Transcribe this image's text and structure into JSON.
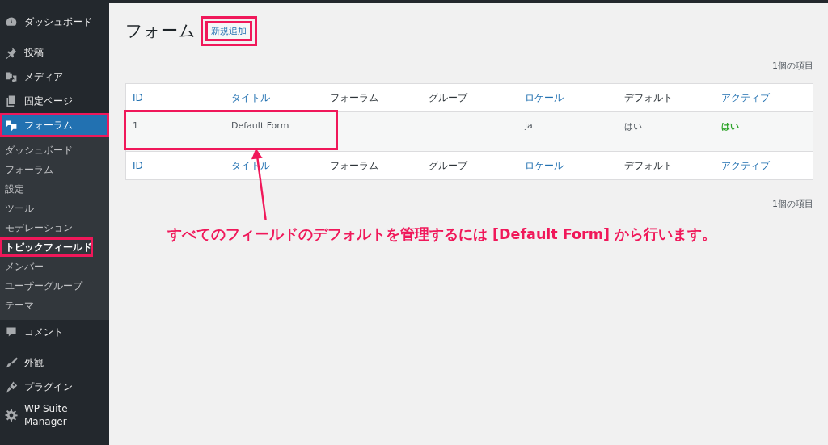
{
  "sidebar": {
    "groups": [
      [
        {
          "label": "ダッシュボード",
          "selected": false,
          "highlighted": false
        }
      ],
      [
        {
          "label": "投稿",
          "selected": false,
          "highlighted": false
        },
        {
          "label": "メディア",
          "selected": false,
          "highlighted": false
        },
        {
          "label": "固定ページ",
          "selected": false,
          "highlighted": false
        },
        {
          "label": "フォーラム",
          "selected": true,
          "highlighted": true,
          "children": [
            {
              "label": "ダッシュボード",
              "selected": false,
              "highlighted": false
            },
            {
              "label": "フォーラム",
              "selected": false,
              "highlighted": false
            },
            {
              "label": "設定",
              "selected": false,
              "highlighted": false
            },
            {
              "label": "ツール",
              "selected": false,
              "highlighted": false
            },
            {
              "label": "モデレーション",
              "selected": false,
              "highlighted": false
            },
            {
              "label": "トピックフィールド",
              "selected": true,
              "highlighted": true
            },
            {
              "label": "メンバー",
              "selected": false,
              "highlighted": false
            },
            {
              "label": "ユーザーグループ",
              "selected": false,
              "highlighted": false
            },
            {
              "label": "テーマ",
              "selected": false,
              "highlighted": false
            }
          ]
        },
        {
          "label": "コメント",
          "selected": false,
          "highlighted": false
        }
      ],
      [
        {
          "label": "外観",
          "selected": false,
          "highlighted": false
        },
        {
          "label": "プラグイン",
          "selected": false,
          "highlighted": false
        },
        {
          "label": "WP Suite Manager",
          "selected": false,
          "highlighted": false
        }
      ]
    ]
  },
  "page": {
    "title": "フォーム",
    "add_button": {
      "label": "新規追加",
      "highlighted": true
    }
  },
  "item_count_top": "1個の項目",
  "table": {
    "columns": [
      {
        "label": "ID",
        "sortable": true
      },
      {
        "label": "タイトル",
        "sortable": true
      },
      {
        "label": "フォーラム",
        "sortable": false
      },
      {
        "label": "グループ",
        "sortable": false
      },
      {
        "label": "ロケール",
        "sortable": true
      },
      {
        "label": "デフォルト",
        "sortable": false
      },
      {
        "label": "アクティブ",
        "sortable": true
      }
    ],
    "rows": [
      {
        "highlighted": true,
        "cells": [
          {
            "text": "1",
            "kind": "plain"
          },
          {
            "text": "Default Form",
            "kind": "plain"
          },
          {
            "text": "",
            "kind": "plain"
          },
          {
            "text": "",
            "kind": "plain"
          },
          {
            "text": "ja",
            "kind": "plain"
          },
          {
            "text": "はい",
            "kind": "plain"
          },
          {
            "text": "はい",
            "kind": "positive"
          }
        ]
      }
    ],
    "footer_columns": [
      {
        "label": "ID",
        "sortable": true
      },
      {
        "label": "タイトル",
        "sortable": true
      },
      {
        "label": "フォーラム",
        "sortable": false
      },
      {
        "label": "グループ",
        "sortable": false
      },
      {
        "label": "ロケール",
        "sortable": true
      },
      {
        "label": "デフォルト",
        "sortable": false
      },
      {
        "label": "アクティブ",
        "sortable": true
      }
    ]
  },
  "item_count_bottom": "1個の項目",
  "annotation": {
    "text": "すべてのフィールドのデフォルトを管理するには [Default Form] から行います。"
  }
}
